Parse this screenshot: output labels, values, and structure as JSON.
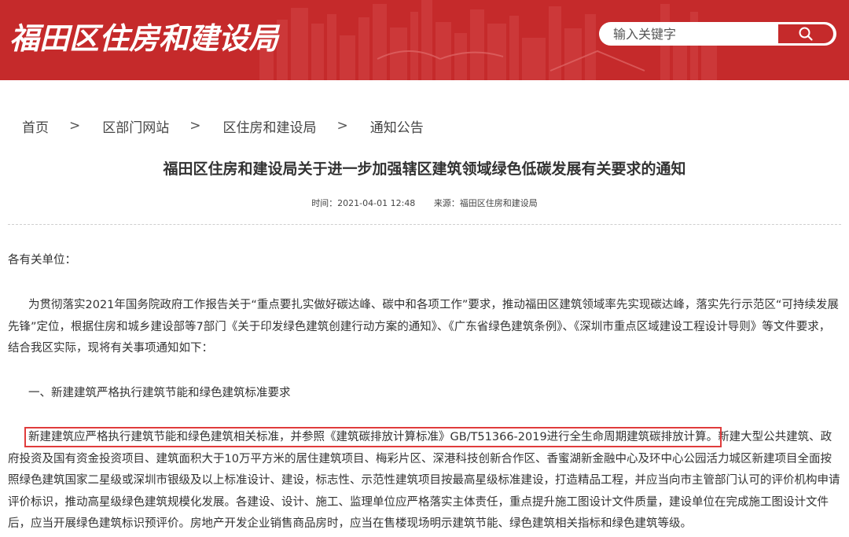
{
  "header": {
    "site_title": "福田区住房和建设局",
    "search": {
      "placeholder": "输入关键字"
    }
  },
  "breadcrumb": [
    "首页",
    "区部门网站",
    "区住房和建设局",
    "通知公告"
  ],
  "breadcrumb_separator": ">",
  "article": {
    "title": "福田区住房和建设局关于进一步加强辖区建筑领域绿色低碳发展有关要求的通知",
    "time": "时间：2021-04-01 12:48",
    "source": "来源：福田区住房和建设局",
    "salutation": "各有关单位：",
    "intro": "为贯彻落实2021年国务院政府工作报告关于“重点要扎实做好碳达峰、碳中和各项工作”要求，推动福田区建筑领域率先实现碳达峰，落实先行示范区“可持续发展先锋”定位，根据住房和城乡建设部等7部门《关于印发绿色建筑创建行动方案的通知》、《广东省绿色建筑条例》、《深圳市重点区域建设工程设计导则》等文件要求，结合我区实际，现将有关事项通知如下：",
    "section_heading": "一、新建建筑严格执行建筑节能和绿色建筑标准要求",
    "section_highlight": "新建建筑应严格执行建筑节能和绿色建筑相关标准，并参照《建筑碳排放计算标准》GB/T51366-2019进行全生命周期建筑碳排放计算。",
    "section_rest": "新建大型公共建筑、政府投资及国有资金投资项目、建筑面积大于10万平方米的居住建筑项目、梅彩片区、深港科技创新合作区、香蜜湖新金融中心及环中心公园活力城区新建项目全面按照绿色建筑国家二星级或深圳市银级及以上标准设计、建设，标志性、示范性建筑项目按最高星级标准建设，打造精品工程，并应当向市主管部门认可的评价机构申请评价标识，推动高星级绿色建筑规模化发展。各建设、设计、施工、监理单位应严格落实主体责任，重点提升施工图设计文件质量，建设单位在完成施工图设计文件后，应当开展绿色建筑标识预评价。房地产开发企业销售商品房时，应当在售楼现场明示建筑节能、绿色建筑相关指标和绿色建筑等级。"
  },
  "colors": {
    "brand_red": "#c52a2b",
    "highlight_border": "#e03c3c"
  },
  "icons": {
    "search": "magnifier-icon"
  }
}
